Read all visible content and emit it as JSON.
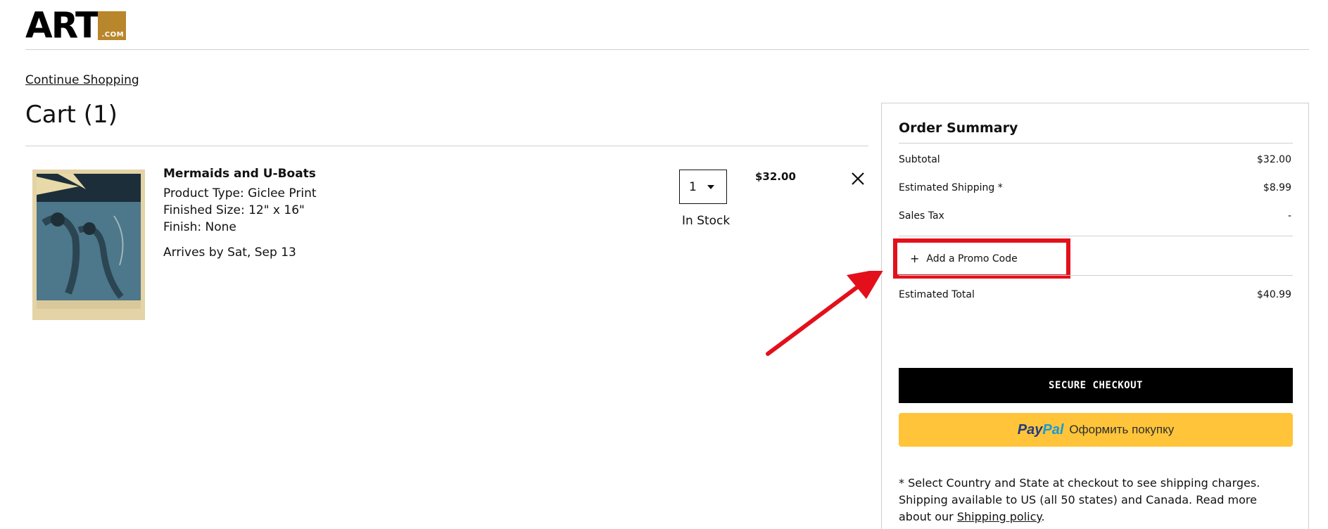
{
  "header": {
    "logo_word": "ART",
    "logo_suffix": ".COM",
    "brand_color": "#b8862b"
  },
  "nav": {
    "continue_shopping": "Continue Shopping"
  },
  "cart": {
    "title": "Cart (1)",
    "items": [
      {
        "name": "Mermaids and U-Boats",
        "product_type": "Product Type: Giclee Print",
        "finished_size": "Finished Size: 12\" x 16\"",
        "finish": "Finish: None",
        "arrival": "Arrives by Sat, Sep 13",
        "quantity": "1",
        "stock_status": "In Stock",
        "price": "$32.00",
        "remove_icon": "close-icon"
      }
    ]
  },
  "summary": {
    "title": "Order Summary",
    "subtotal_label": "Subtotal",
    "subtotal_value": "$32.00",
    "shipping_label": "Estimated Shipping *",
    "shipping_value": "$8.99",
    "tax_label": "Sales Tax",
    "tax_value": "-",
    "promo_icon": "plus-icon",
    "promo_label": "Add a Promo Code",
    "total_label": "Estimated Total",
    "total_value": "$40.99",
    "checkout_label": "SECURE CHECKOUT",
    "paypal_pay": "Pay",
    "paypal_pal": "Pal",
    "paypal_label": "Оформить покупку",
    "shipping_note": "* Select Country and State at checkout to see shipping charges. Shipping available to US (all 50 states) and Canada. Read more about our ",
    "shipping_policy_link": "Shipping policy",
    "shipping_note_end": "."
  },
  "colors": {
    "highlight": "#e3101b",
    "paypal_yellow": "#ffc439",
    "checkout_black": "#000000"
  }
}
